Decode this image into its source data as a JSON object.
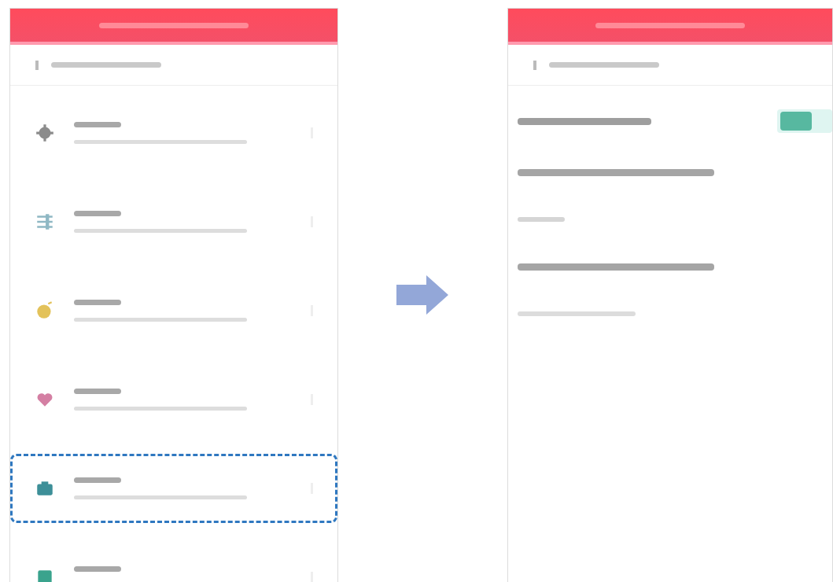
{
  "left_screen": {
    "items": [
      {
        "color": "#8c8c8c",
        "highlighted": false
      },
      {
        "color": "#8fb8c4",
        "highlighted": false
      },
      {
        "color": "#e3c25a",
        "highlighted": false
      },
      {
        "color": "#d47fa3",
        "highlighted": false
      },
      {
        "color": "#3d8f98",
        "highlighted": true
      },
      {
        "color": "#3aa38d",
        "highlighted": false
      }
    ]
  },
  "right_screen": {
    "rows": [
      {
        "kind": "toggle",
        "on": true
      },
      {
        "kind": "heading"
      },
      {
        "kind": "chip"
      },
      {
        "kind": "heading"
      },
      {
        "kind": "note"
      }
    ]
  }
}
